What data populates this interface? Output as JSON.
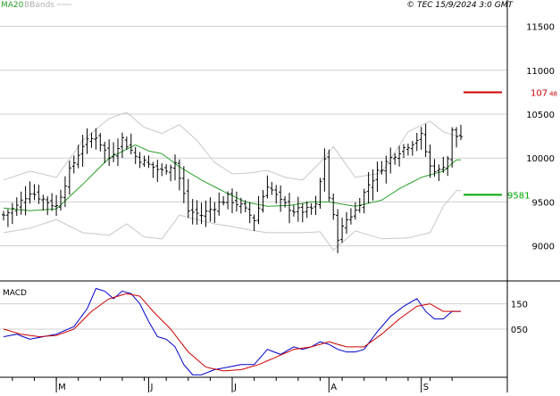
{
  "legend": {
    "ma_label": "MA20",
    "bb_label": "BBands"
  },
  "timestamp": "© TEC 15/9/2024 3:0 GMT",
  "colors": {
    "ma": "#2ca02c",
    "bands": "#c8c8c8",
    "price": "#000000",
    "resistance": "#cc0000",
    "support": "#00aa00",
    "macd": "#0000cc",
    "signal": "#cc0000",
    "grid": "#d0d0d0"
  },
  "levels": {
    "resistance": {
      "value": 107.48,
      "label_main": "107",
      "label_small": "48"
    },
    "support": {
      "value": 95.81,
      "label": "9581"
    }
  },
  "chart_data": [
    {
      "type": "line",
      "ylim": [
        86,
        118
      ],
      "yticks": [
        {
          "value": 115,
          "label": "11500"
        },
        {
          "value": 110,
          "label": "11000"
        },
        {
          "value": 105,
          "label": "10500"
        },
        {
          "value": 100,
          "label": "10000"
        },
        {
          "value": 95,
          "label": "9500"
        },
        {
          "value": 90,
          "label": "9000"
        }
      ],
      "x_ticks": [
        {
          "i": 12,
          "label": "M"
        },
        {
          "i": 33,
          "label": "J"
        },
        {
          "i": 52,
          "label": "J"
        },
        {
          "i": 74,
          "label": "A"
        },
        {
          "i": 95,
          "label": "S"
        }
      ],
      "x_count": 105,
      "grid": true,
      "anchors": {
        "close": [
          [
            0,
            93.5
          ],
          [
            3,
            94.5
          ],
          [
            6,
            96.2
          ],
          [
            9,
            95.3
          ],
          [
            12,
            94.5
          ],
          [
            15,
            98.5
          ],
          [
            18,
            101.5
          ],
          [
            21,
            102.5
          ],
          [
            24,
            100
          ],
          [
            27,
            102.2
          ],
          [
            30,
            100.2
          ],
          [
            33,
            99.2
          ],
          [
            36,
            98.5
          ],
          [
            39,
            99.5
          ],
          [
            42,
            94
          ],
          [
            45,
            93.5
          ],
          [
            48,
            94.5
          ],
          [
            51,
            95.5
          ],
          [
            54,
            94.5
          ],
          [
            57,
            93
          ],
          [
            60,
            97
          ],
          [
            63,
            95
          ],
          [
            66,
            94
          ],
          [
            69,
            94
          ],
          [
            71,
            94.5
          ],
          [
            73,
            100
          ],
          [
            74,
            95.5
          ],
          [
            76,
            91
          ],
          [
            78,
            93
          ],
          [
            80,
            94
          ],
          [
            83,
            97
          ],
          [
            86,
            99
          ],
          [
            89,
            100.5
          ],
          [
            92,
            101.5
          ],
          [
            95,
            102.5
          ],
          [
            97,
            99
          ],
          [
            99,
            98.5
          ],
          [
            101,
            100
          ],
          [
            102,
            103
          ],
          [
            103,
            102.5
          ]
        ],
        "ma20": [
          [
            0,
            94.3
          ],
          [
            6,
            94
          ],
          [
            12,
            94.2
          ],
          [
            18,
            97
          ],
          [
            24,
            100
          ],
          [
            30,
            101.5
          ],
          [
            33,
            100.8
          ],
          [
            36,
            100.5
          ],
          [
            40,
            99
          ],
          [
            45,
            97.5
          ],
          [
            50,
            96.2
          ],
          [
            55,
            95
          ],
          [
            60,
            94.5
          ],
          [
            65,
            94.6
          ],
          [
            70,
            95
          ],
          [
            74,
            95
          ],
          [
            80,
            94.5
          ],
          [
            86,
            95.2
          ],
          [
            90,
            96.5
          ],
          [
            95,
            97.8
          ],
          [
            100,
            98.5
          ],
          [
            103,
            99.8
          ]
        ],
        "upper": [
          [
            0,
            97.5
          ],
          [
            6,
            98.5
          ],
          [
            12,
            97.8
          ],
          [
            18,
            102
          ],
          [
            24,
            104.5
          ],
          [
            28,
            105.2
          ],
          [
            32,
            103.5
          ],
          [
            36,
            102.8
          ],
          [
            40,
            103.8
          ],
          [
            44,
            102
          ],
          [
            48,
            99.5
          ],
          [
            52,
            98.2
          ],
          [
            56,
            98.3
          ],
          [
            60,
            98.6
          ],
          [
            64,
            97.8
          ],
          [
            68,
            97.5
          ],
          [
            72,
            99.5
          ],
          [
            75,
            101.3
          ],
          [
            80,
            97.8
          ],
          [
            86,
            98.3
          ],
          [
            92,
            103
          ],
          [
            97,
            104.2
          ],
          [
            100,
            103
          ],
          [
            103,
            102.5
          ]
        ],
        "lower": [
          [
            0,
            91.5
          ],
          [
            6,
            92
          ],
          [
            12,
            93
          ],
          [
            18,
            91.5
          ],
          [
            24,
            91.2
          ],
          [
            28,
            92.5
          ],
          [
            32,
            91
          ],
          [
            36,
            90.8
          ],
          [
            40,
            93.5
          ],
          [
            44,
            93
          ],
          [
            48,
            92.5
          ],
          [
            52,
            92.2
          ],
          [
            56,
            91.8
          ],
          [
            60,
            91.5
          ],
          [
            64,
            91.5
          ],
          [
            68,
            91.5
          ],
          [
            72,
            91.6
          ],
          [
            75,
            89.5
          ],
          [
            80,
            91.7
          ],
          [
            86,
            90.8
          ],
          [
            92,
            90.9
          ],
          [
            97,
            91.5
          ],
          [
            100,
            94.5
          ],
          [
            103,
            96.3
          ]
        ]
      }
    },
    {
      "type": "line",
      "title": "MACD",
      "ylim": [
        -1.4,
        2.4
      ],
      "yticks": [
        {
          "value": 1.5,
          "label": "150"
        },
        {
          "value": 0.5,
          "label": "050"
        }
      ],
      "series": [
        {
          "key": "macd",
          "anchors": [
            [
              0,
              0.2
            ],
            [
              3,
              0.3
            ],
            [
              6,
              0.1
            ],
            [
              9,
              0.2
            ],
            [
              12,
              0.3
            ],
            [
              16,
              0.6
            ],
            [
              19,
              1.3
            ],
            [
              21,
              2.1
            ],
            [
              23,
              2.0
            ],
            [
              25,
              1.7
            ],
            [
              27,
              2.0
            ],
            [
              29,
              1.9
            ],
            [
              31,
              1.5
            ],
            [
              33,
              0.8
            ],
            [
              35,
              0.2
            ],
            [
              37,
              0.1
            ],
            [
              39,
              -0.2
            ],
            [
              41,
              -0.9
            ],
            [
              43,
              -1.3
            ],
            [
              45,
              -1.3
            ],
            [
              48,
              -1.1
            ],
            [
              51,
              -1.0
            ],
            [
              54,
              -0.9
            ],
            [
              57,
              -0.9
            ],
            [
              60,
              -0.3
            ],
            [
              63,
              -0.5
            ],
            [
              66,
              -0.2
            ],
            [
              68,
              -0.3
            ],
            [
              70,
              -0.2
            ],
            [
              72,
              0.0
            ],
            [
              74,
              -0.1
            ],
            [
              76,
              -0.3
            ],
            [
              78,
              -0.4
            ],
            [
              80,
              -0.4
            ],
            [
              82,
              -0.3
            ],
            [
              85,
              0.4
            ],
            [
              88,
              1.0
            ],
            [
              91,
              1.4
            ],
            [
              94,
              1.7
            ],
            [
              96,
              1.2
            ],
            [
              98,
              0.9
            ],
            [
              100,
              0.9
            ],
            [
              102,
              1.2
            ]
          ]
        },
        {
          "key": "signal",
          "anchors": [
            [
              0,
              0.5
            ],
            [
              4,
              0.3
            ],
            [
              8,
              0.2
            ],
            [
              12,
              0.25
            ],
            [
              16,
              0.5
            ],
            [
              20,
              1.2
            ],
            [
              24,
              1.7
            ],
            [
              28,
              1.9
            ],
            [
              31,
              1.8
            ],
            [
              34,
              1.2
            ],
            [
              38,
              0.5
            ],
            [
              42,
              -0.4
            ],
            [
              46,
              -1.0
            ],
            [
              50,
              -1.15
            ],
            [
              54,
              -1.1
            ],
            [
              58,
              -0.9
            ],
            [
              62,
              -0.6
            ],
            [
              66,
              -0.3
            ],
            [
              70,
              -0.2
            ],
            [
              74,
              0.0
            ],
            [
              78,
              -0.2
            ],
            [
              82,
              -0.2
            ],
            [
              86,
              0.3
            ],
            [
              90,
              0.9
            ],
            [
              94,
              1.4
            ],
            [
              97,
              1.5
            ],
            [
              100,
              1.2
            ],
            [
              103,
              1.2
            ]
          ]
        }
      ]
    }
  ]
}
